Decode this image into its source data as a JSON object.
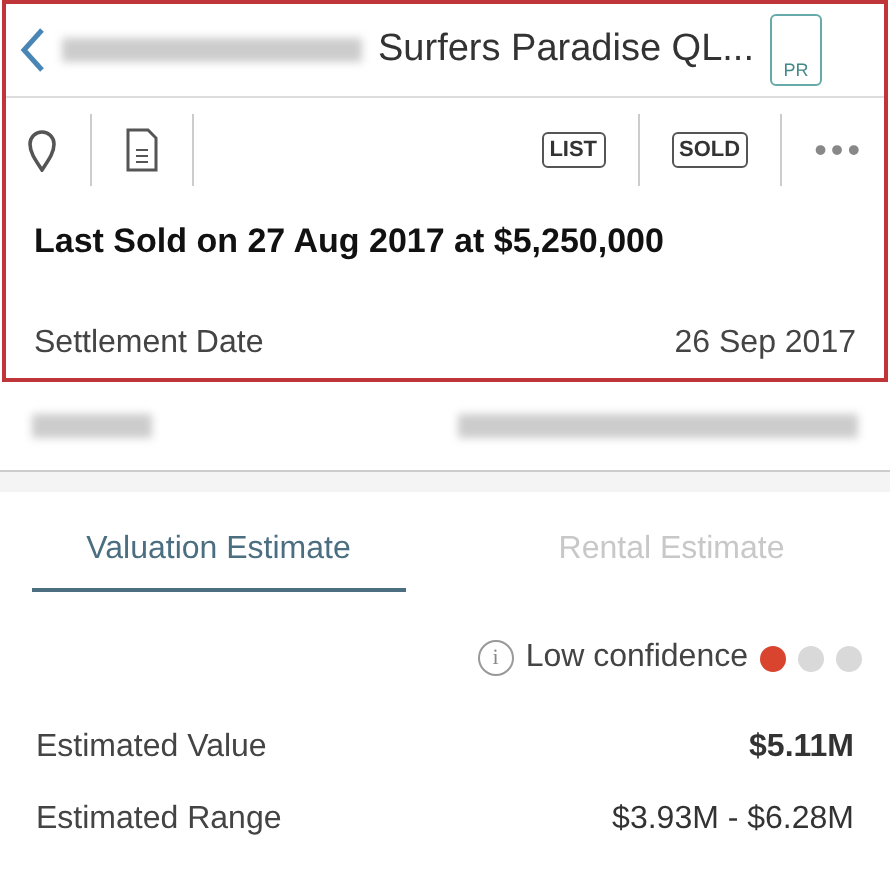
{
  "header": {
    "title": "Surfers Paradise QL...",
    "badge": "PR"
  },
  "toolbar": {
    "tags": [
      "LIST",
      "SOLD"
    ],
    "more": "•••"
  },
  "sale": {
    "headline": "Last Sold on 27 Aug 2017 at $5,250,000",
    "settlement_label": "Settlement Date",
    "settlement_value": "26 Sep 2017"
  },
  "tabs": [
    {
      "label": "Valuation Estimate",
      "selected": true
    },
    {
      "label": "Rental Estimate",
      "selected": false
    }
  ],
  "confidence": {
    "icon": "i",
    "label": "Low confidence",
    "dots": [
      {
        "color": "#d9442f"
      },
      {
        "color": "#d9d9d9"
      },
      {
        "color": "#d9d9d9"
      }
    ]
  },
  "estimates": [
    {
      "label": "Estimated Value",
      "value": "$5.11M",
      "kind": "bold"
    },
    {
      "label": "Estimated Range",
      "value": "$3.93M - $6.28M",
      "kind": "plain"
    }
  ]
}
